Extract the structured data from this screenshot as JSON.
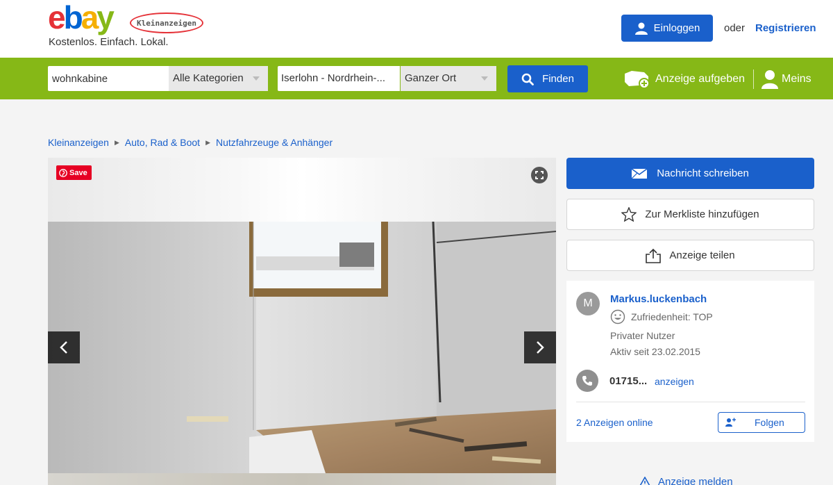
{
  "header": {
    "logo_letters": [
      "e",
      "b",
      "a",
      "y"
    ],
    "logo_badge": "Kleinanzeigen",
    "tagline": "Kostenlos. Einfach. Lokal.",
    "login_label": "Einloggen",
    "or_text": "oder",
    "register_label": "Registrieren"
  },
  "search": {
    "query": "wohnkabine",
    "category": "Alle Kategorien",
    "location": "Iserlohn - Nordrhein-...",
    "radius": "Ganzer Ort",
    "find_label": "Finden",
    "post_ad_label": "Anzeige aufgeben",
    "my_label": "Meins"
  },
  "breadcrumb": {
    "items": [
      "Kleinanzeigen",
      "Auto, Rad & Boot",
      "Nutzfahrzeuge & Anhänger"
    ]
  },
  "gallery": {
    "pin_label": "Save"
  },
  "actions": {
    "message_label": "Nachricht schreiben",
    "watchlist_label": "Zur Merkliste hinzufügen",
    "share_label": "Anzeige teilen",
    "report_label": "Anzeige melden"
  },
  "seller": {
    "initial": "M",
    "name": "Markus.luckenbach",
    "satisfaction": "Zufriedenheit: TOP",
    "type": "Privater Nutzer",
    "since": "Aktiv seit 23.02.2015",
    "phone": "01715...",
    "phone_reveal": "anzeigen",
    "ads_online": "2 Anzeigen online",
    "follow_label": "Folgen"
  },
  "colors": {
    "brand_blue": "#1a60cb",
    "brand_green": "#86b817",
    "pinterest_red": "#e60023"
  }
}
